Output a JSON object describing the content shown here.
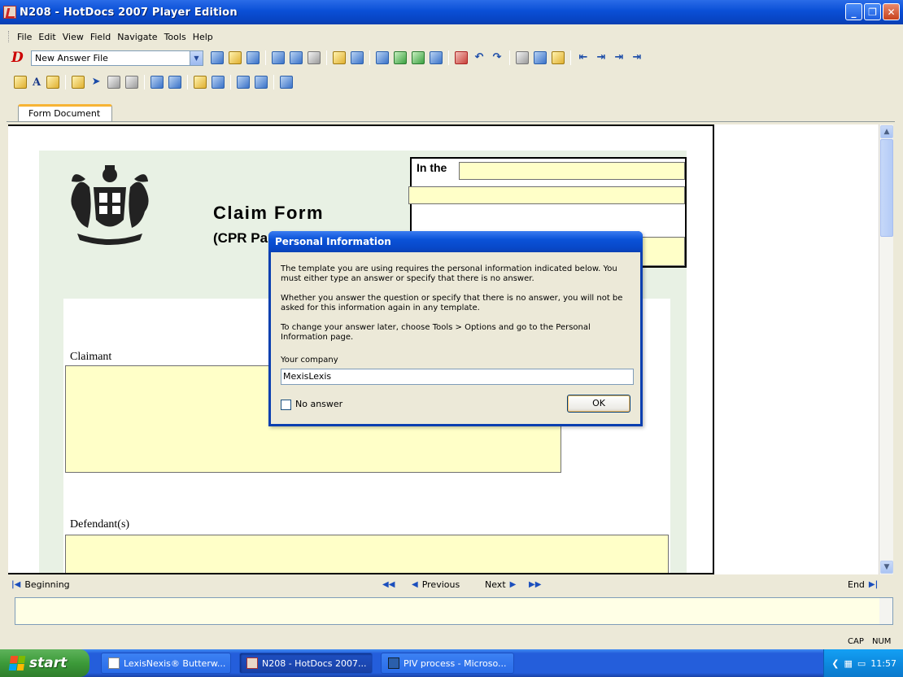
{
  "window": {
    "title": "N208 - HotDocs 2007 Player Edition"
  },
  "menu": [
    "File",
    "Edit",
    "View",
    "Field",
    "Navigate",
    "Tools",
    "Help"
  ],
  "toolbar": {
    "answer_file": "New Answer File",
    "text_tool": "A"
  },
  "tab": {
    "label": "Form Document"
  },
  "form": {
    "title": "Claim Form",
    "subtitle": "(CPR Part 8)",
    "in_the_label": "In the",
    "claimant_label": "Claimant",
    "defendant_label": "Defendant(s)"
  },
  "nav": {
    "beginning": "Beginning",
    "previous": "Previous",
    "next": "Next",
    "end": "End"
  },
  "status": {
    "cap": "CAP",
    "num": "NUM"
  },
  "dialog": {
    "title": "Personal Information",
    "p1": "The template you are using requires the personal information indicated below. You must either type an answer or specify that there is no answer.",
    "p2": "Whether you answer the question or specify that there is no answer, you will not be asked for this information again in any template.",
    "p3": "To change your answer later, choose Tools > Options and go to the Personal Information page.",
    "field_label": "Your company",
    "field_value": "MexisLexis",
    "no_answer_label": "No answer",
    "ok_label": "OK"
  },
  "taskbar": {
    "start": "start",
    "tasks": [
      "LexisNexis® Butterw...",
      "N208 - HotDocs 2007...",
      "PIV process - Microso..."
    ],
    "clock": "11:57"
  }
}
